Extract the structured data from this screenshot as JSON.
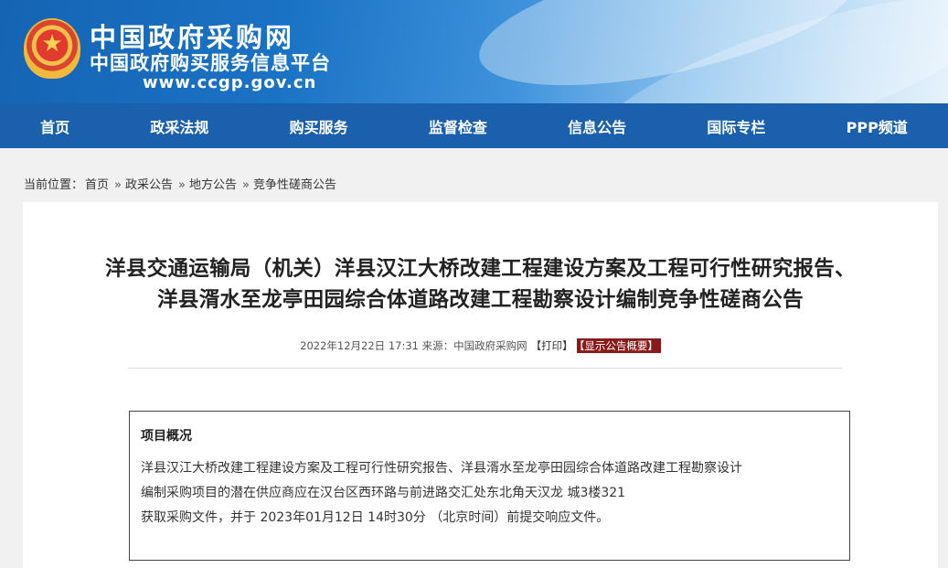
{
  "header": {
    "emblem_glyph": "★",
    "site_title": "中国政府采购网",
    "site_subtitle": "中国政府购买服务信息平台",
    "site_url": "www.ccgp.gov.cn"
  },
  "nav": {
    "items": [
      "首页",
      "政采法规",
      "购买服务",
      "监督检查",
      "信息公告",
      "国际专栏",
      "PPP频道"
    ]
  },
  "breadcrumb": {
    "label": "当前位置：",
    "items": [
      "首页",
      "政采公告",
      "地方公告",
      "竞争性磋商公告"
    ],
    "separator": "»"
  },
  "article": {
    "title_line1": "洋县交通运输局（机关）洋县汉江大桥改建工程建设方案及工程可行性研究报告、",
    "title_line2": "洋县湑水至龙亭田园综合体道路改建工程勘察设计编制竞争性磋商公告",
    "meta_text": "2022年12月22日 17:31 来源：中国政府采购网",
    "print_label": "【打印】",
    "summary_label": "【显示公告概要】"
  },
  "overview": {
    "heading": "项目概况",
    "lines": [
      "洋县汉江大桥改建工程建设方案及工程可行性研究报告、洋县湑水至龙亭田园综合体道路改建工程勘察设计",
      "编制采购项目的潜在供应商应在汉台区西环路与前进路交汇处东北角天汉龙 城3楼321",
      "获取采购文件，并于 2023年01月12日 14时30分 （北京时间）前提交响应文件。"
    ]
  },
  "colors": {
    "nav_bg": "#1a60ad",
    "summary_btn_bg": "#8a1a1a",
    "page_bg": "#f1f1f1"
  }
}
